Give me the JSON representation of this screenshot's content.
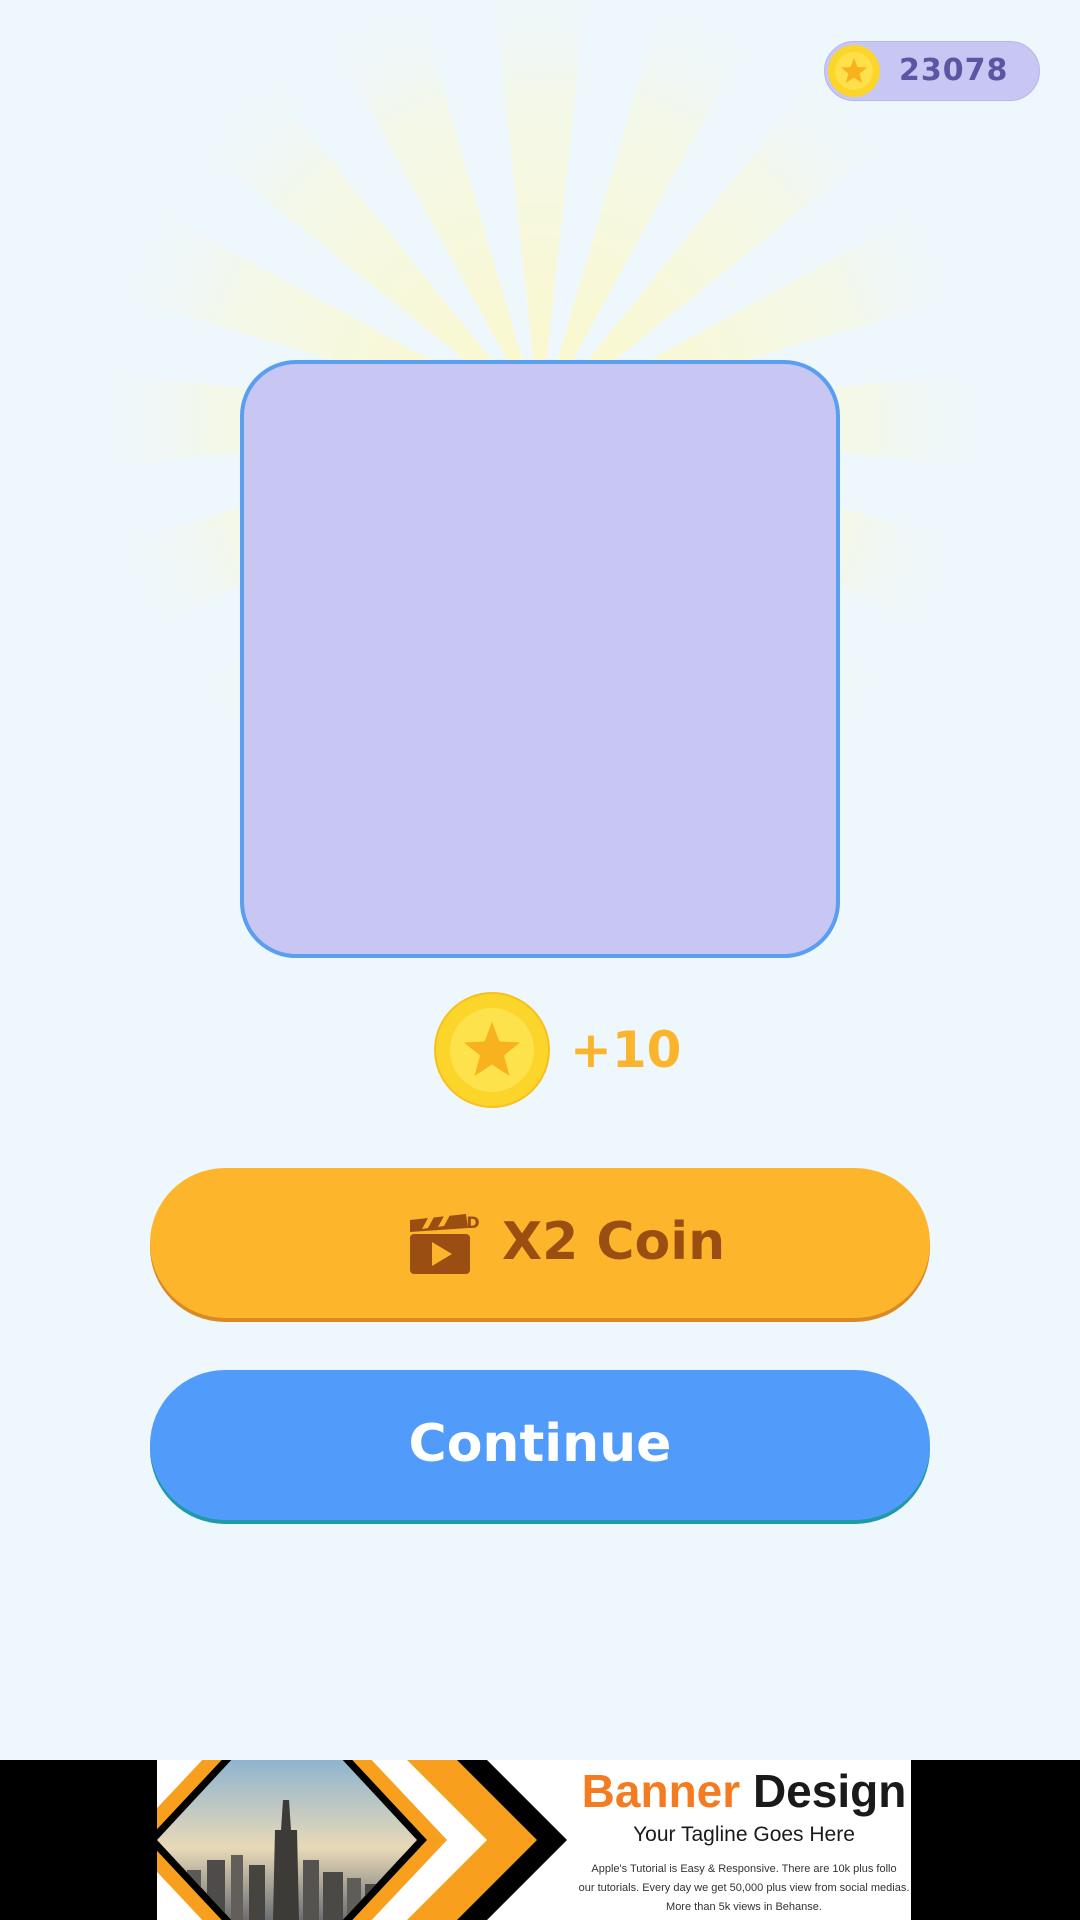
{
  "header": {
    "coin_count": "23078",
    "coin_icon": "star-coin-icon"
  },
  "reward": {
    "amount_text": "+10",
    "coin_icon": "star-coin-icon"
  },
  "buttons": {
    "double_label": "X2 Coin",
    "double_icon": "video-ad-icon",
    "ad_badge": "AD",
    "continue_label": "Continue"
  },
  "ad_banner": {
    "title_part1": "Banner",
    "title_part2": "Design",
    "tagline": "Your Tagline Goes Here",
    "body_line1": "Apple's Tutorial is Easy & Responsive. There are 10k plus follo",
    "body_line2": "our tutorials. Every day we get 50,000 plus view from social medias.",
    "body_line3": "More than 5k views in Behanse."
  },
  "colors": {
    "background": "#eef7fc",
    "coin_gold": "#fbd52a",
    "x2_button": "#fdb52c",
    "continue_button": "#519cfb",
    "card_fill": "#c8c6f3",
    "card_border": "#5a9ef2"
  }
}
